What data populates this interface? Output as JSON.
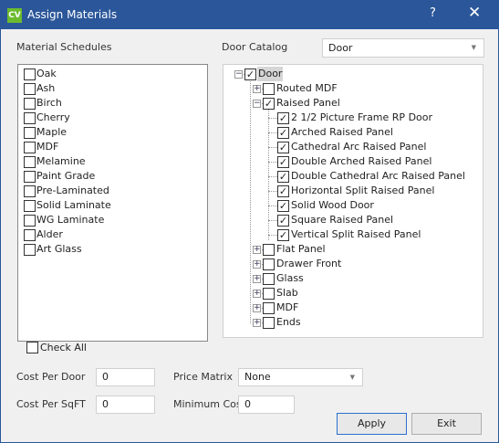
{
  "window": {
    "title": "Assign Materials",
    "logo": "CV",
    "help": "?",
    "close": "✕"
  },
  "materials": {
    "label": "Material Schedules",
    "items": [
      {
        "label": "Oak",
        "checked": false
      },
      {
        "label": "Ash",
        "checked": false
      },
      {
        "label": "Birch",
        "checked": false
      },
      {
        "label": "Cherry",
        "checked": false
      },
      {
        "label": "Maple",
        "checked": false
      },
      {
        "label": "MDF",
        "checked": false
      },
      {
        "label": "Melamine",
        "checked": false
      },
      {
        "label": "Paint Grade",
        "checked": false
      },
      {
        "label": "Pre-Laminated",
        "checked": false
      },
      {
        "label": "Solid Laminate",
        "checked": false
      },
      {
        "label": "WG Laminate",
        "checked": false
      },
      {
        "label": "Alder",
        "checked": false
      },
      {
        "label": "Art Glass",
        "checked": false
      }
    ],
    "check_all": "Check All"
  },
  "catalog": {
    "label": "Door Catalog",
    "selected": "Door",
    "tree": [
      {
        "label": "Door",
        "level": 0,
        "checked": true,
        "expander": "-",
        "selected": true
      },
      {
        "label": "Routed MDF",
        "level": 1,
        "checked": false,
        "expander": "+"
      },
      {
        "label": "Raised Panel",
        "level": 1,
        "checked": true,
        "expander": "-"
      },
      {
        "label": "2 1/2 Picture Frame RP Door",
        "level": 2,
        "checked": true
      },
      {
        "label": "Arched Raised Panel",
        "level": 2,
        "checked": true
      },
      {
        "label": "Cathedral Arc Raised Panel",
        "level": 2,
        "checked": true
      },
      {
        "label": "Double Arched Raised Panel",
        "level": 2,
        "checked": true
      },
      {
        "label": "Double Cathedral Arc Raised Panel",
        "level": 2,
        "checked": true
      },
      {
        "label": "Horizontal Split Raised Panel",
        "level": 2,
        "checked": true
      },
      {
        "label": "Solid Wood Door",
        "level": 2,
        "checked": true
      },
      {
        "label": "Square Raised Panel",
        "level": 2,
        "checked": true
      },
      {
        "label": "Vertical Split Raised Panel",
        "level": 2,
        "checked": true
      },
      {
        "label": "Flat Panel",
        "level": 1,
        "checked": false,
        "expander": "+"
      },
      {
        "label": "Drawer Front",
        "level": 1,
        "checked": false,
        "expander": "+"
      },
      {
        "label": "Glass",
        "level": 1,
        "checked": false,
        "expander": "+"
      },
      {
        "label": "Slab",
        "level": 1,
        "checked": false,
        "expander": "+"
      },
      {
        "label": "MDF",
        "level": 1,
        "checked": false,
        "expander": "+"
      },
      {
        "label": "Ends",
        "level": 1,
        "checked": false,
        "expander": "+"
      }
    ]
  },
  "costs": {
    "cost_per_door_label": "Cost Per Door",
    "cost_per_door": "0",
    "cost_per_sqft_label": "Cost Per SqFT",
    "cost_per_sqft": "0",
    "price_matrix_label": "Price Matrix",
    "price_matrix": "None",
    "minimum_cost_label": "Minimum Cost",
    "minimum_cost": "0"
  },
  "buttons": {
    "apply": "Apply",
    "exit": "Exit"
  }
}
